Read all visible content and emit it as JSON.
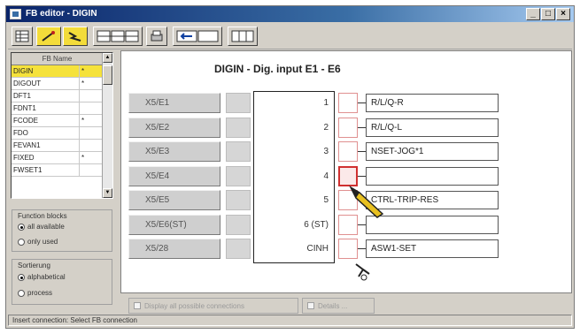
{
  "window": {
    "title": "FB editor - DIGIN",
    "minimize": "_",
    "maximize": "□",
    "close": "×"
  },
  "toolbar": {
    "buttons": [
      {
        "name": "table-icon",
        "highlight": false
      },
      {
        "name": "connect-wire-icon",
        "highlight": true
      },
      {
        "name": "disconnect-wire-icon",
        "highlight": true
      },
      {
        "name": "grid-view-icon",
        "highlight": false
      },
      {
        "name": "split-view-icon",
        "highlight": false
      },
      {
        "name": "print-icon",
        "highlight": false
      },
      {
        "name": "insert-icon",
        "highlight": false
      },
      {
        "name": "signal-view-icon",
        "highlight": false
      }
    ]
  },
  "fb_list": {
    "header": "FB Name",
    "items": [
      {
        "name": "DIGIN",
        "flag": "*",
        "selected": true
      },
      {
        "name": "DIGOUT",
        "flag": "*",
        "selected": false
      },
      {
        "name": "DFT1",
        "flag": "",
        "selected": false
      },
      {
        "name": "FDNT1",
        "flag": "",
        "selected": false
      },
      {
        "name": "FCODE",
        "flag": "*",
        "selected": false
      },
      {
        "name": "FDO",
        "flag": "",
        "selected": false
      },
      {
        "name": "FEVAN1",
        "flag": "",
        "selected": false
      },
      {
        "name": "FIXED",
        "flag": "*",
        "selected": false
      },
      {
        "name": "FWSET1",
        "flag": "",
        "selected": false
      }
    ]
  },
  "function_blocks": {
    "label": "Function blocks",
    "options": [
      {
        "label": "all available",
        "checked": true
      },
      {
        "label": "only used",
        "checked": false
      }
    ]
  },
  "sorting": {
    "label": "Sortierung",
    "options": [
      {
        "label": "alphabetical",
        "checked": true
      },
      {
        "label": "process",
        "checked": false
      }
    ]
  },
  "diagram": {
    "title": "DIGIN - Dig. input E1 - E6",
    "inputs": [
      "X5/E1",
      "X5/E2",
      "X5/E3",
      "X5/E4",
      "X5/E5",
      "X5/E6(ST)",
      "X5/28"
    ],
    "pins": [
      "1",
      "2",
      "3",
      "4",
      "5",
      "6 (ST)",
      "CINH"
    ],
    "outputs": [
      "R/L/Q-R",
      "R/L/Q-L",
      "NSET-JOG*1",
      "",
      "CTRL-TRIP-RES",
      "",
      "ASW1-SET"
    ],
    "active_pin_index": 3
  },
  "bottom_options": {
    "show_all": "Display all possible connections",
    "details": "Details ..."
  },
  "status_bar": {
    "text": "Insert connection: Select FB connection"
  }
}
